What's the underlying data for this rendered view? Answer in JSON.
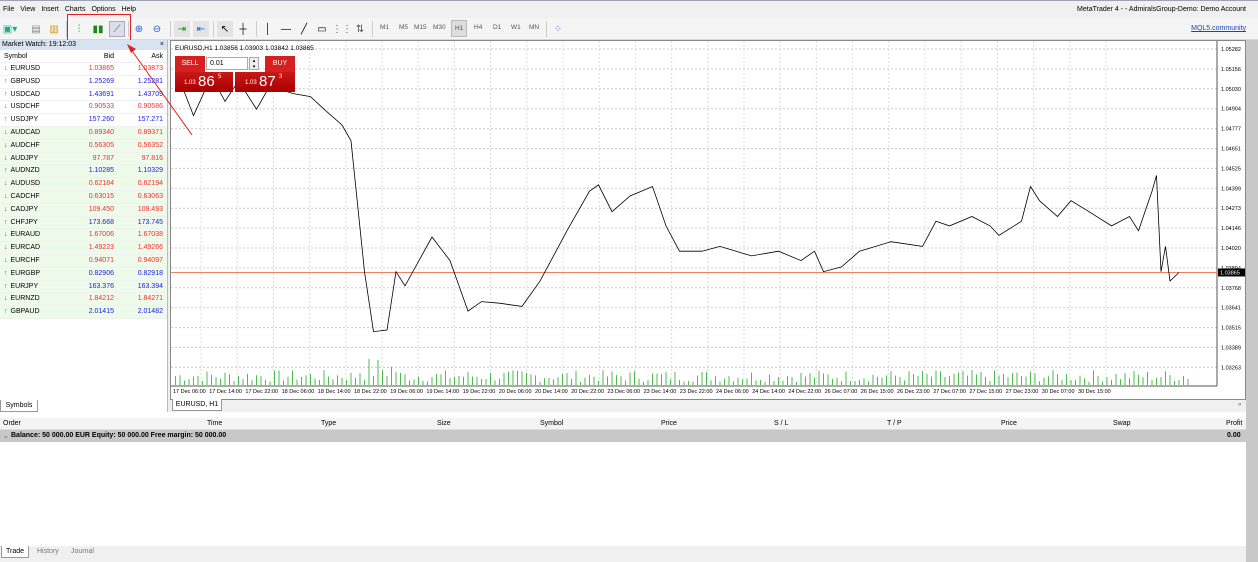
{
  "menu": [
    "File",
    "View",
    "Insert",
    "Charts",
    "Options",
    "Help"
  ],
  "window_title": "MetaTrader 4 -            - AdmiralsGroup-Demo: Demo Account",
  "timeframes": [
    "M1",
    "M5",
    "M15",
    "M30",
    "H1",
    "H4",
    "D1",
    "W1",
    "MN"
  ],
  "active_timeframe": "H1",
  "mql_link": "MQL5.community",
  "market_watch": {
    "title": "Market Watch: 19:12:03",
    "headers": {
      "symbol": "Symbol",
      "bid": "Bid",
      "ask": "Ask"
    },
    "rows": [
      {
        "symbol": "EURUSD",
        "bid": "1.03865",
        "ask": "1.03873",
        "dir": "down"
      },
      {
        "symbol": "GBPUSD",
        "bid": "1.25269",
        "ask": "1.25281",
        "dir": "up"
      },
      {
        "symbol": "USDCAD",
        "bid": "1.43691",
        "ask": "1.43709",
        "dir": "up"
      },
      {
        "symbol": "USDCHF",
        "bid": "0.90533",
        "ask": "0.90586",
        "dir": "down"
      },
      {
        "symbol": "USDJPY",
        "bid": "157.260",
        "ask": "157.271",
        "dir": "up"
      },
      {
        "symbol": "AUDCAD",
        "bid": "0.89340",
        "ask": "0.89371",
        "dir": "down"
      },
      {
        "symbol": "AUDCHF",
        "bid": "0.56305",
        "ask": "0.56352",
        "dir": "down"
      },
      {
        "symbol": "AUDJPY",
        "bid": "97.787",
        "ask": "97.816",
        "dir": "down"
      },
      {
        "symbol": "AUDNZD",
        "bid": "1.10285",
        "ask": "1.10329",
        "dir": "up"
      },
      {
        "symbol": "AUDUSD",
        "bid": "0.62184",
        "ask": "0.62194",
        "dir": "down"
      },
      {
        "symbol": "CADCHF",
        "bid": "0.63015",
        "ask": "0.63063",
        "dir": "down"
      },
      {
        "symbol": "CADJPY",
        "bid": "109.450",
        "ask": "109.493",
        "dir": "down"
      },
      {
        "symbol": "CHFJPY",
        "bid": "173.668",
        "ask": "173.745",
        "dir": "up"
      },
      {
        "symbol": "EURAUD",
        "bid": "1.67006",
        "ask": "1.67038",
        "dir": "down"
      },
      {
        "symbol": "EURCAD",
        "bid": "1.49223",
        "ask": "1.49266",
        "dir": "down"
      },
      {
        "symbol": "EURCHF",
        "bid": "0.94071",
        "ask": "0.94097",
        "dir": "down"
      },
      {
        "symbol": "EURGBP",
        "bid": "0.82906",
        "ask": "0.82918",
        "dir": "up"
      },
      {
        "symbol": "EURJPY",
        "bid": "163.376",
        "ask": "163.394",
        "dir": "up"
      },
      {
        "symbol": "EURNZD",
        "bid": "1.84212",
        "ask": "1.84271",
        "dir": "down"
      },
      {
        "symbol": "GBPAUD",
        "bid": "2.01415",
        "ask": "2.01482",
        "dir": "up"
      }
    ],
    "tab": "Symbols"
  },
  "chart": {
    "header": "EURUSD,H1  1.03856 1.03903 1.03842 1.03865",
    "sell_label": "SELL",
    "buy_label": "BUY",
    "lot": "0.01",
    "sell_prefix": "1.03",
    "sell_big": "86",
    "sell_sup": "5",
    "buy_prefix": "1.03",
    "buy_big": "87",
    "buy_sup": "3",
    "tab": "EURUSD, H1",
    "current_price": "1.03865",
    "price_ticks": [
      "1.05282",
      "1.05156",
      "1.05030",
      "1.04904",
      "1.04777",
      "1.04651",
      "1.04525",
      "1.04399",
      "1.04273",
      "1.04146",
      "1.04020",
      "1.03894",
      "1.03768",
      "1.03641",
      "1.03515",
      "1.03389",
      "1.03263"
    ],
    "time_ticks": [
      "17 Dec 06:00",
      "17 Dec 14:00",
      "17 Dec 22:00",
      "18 Dec 06:00",
      "18 Dec 14:00",
      "18 Dec 22:00",
      "19 Dec 06:00",
      "19 Dec 14:00",
      "19 Dec 22:00",
      "20 Dec 06:00",
      "20 Dec 14:00",
      "20 Dec 22:00",
      "23 Dec 06:00",
      "23 Dec 14:00",
      "23 Dec 22:00",
      "24 Dec 06:00",
      "24 Dec 14:00",
      "24 Dec 22:00",
      "26 Dec 07:00",
      "26 Dec 15:00",
      "26 Dec 23:00",
      "27 Dec 07:00",
      "27 Dec 15:00",
      "27 Dec 23:00",
      "30 Dec 07:00",
      "30 Dec 15:00"
    ]
  },
  "chart_data": {
    "type": "line",
    "title": "EURUSD,H1",
    "ylim": [
      1.032,
      1.053
    ],
    "x": [
      1,
      4,
      8,
      11,
      14,
      18,
      21,
      26,
      30,
      33,
      37,
      39,
      42,
      44,
      47,
      49,
      51,
      57,
      61,
      65,
      68,
      72,
      77,
      81,
      87,
      92,
      94,
      97,
      101,
      106,
      109,
      112,
      117,
      121,
      128,
      134,
      139,
      142,
      144,
      148,
      152,
      159,
      166,
      169,
      172,
      177,
      181,
      183,
      188,
      190,
      192,
      196,
      199,
      203,
      208,
      212,
      214,
      217,
      218,
      219,
      220,
      221,
      223
    ],
    "y": [
      1.0508,
      1.0486,
      1.0511,
      1.0495,
      1.0508,
      1.049,
      1.0505,
      1.05,
      1.0498,
      1.049,
      1.048,
      1.047,
      1.0387,
      1.0349,
      1.035,
      1.0387,
      1.0378,
      1.0409,
      1.0394,
      1.0362,
      1.0368,
      1.0367,
      1.0365,
      1.0381,
      1.0413,
      1.0438,
      1.0442,
      1.0425,
      1.0435,
      1.0441,
      1.0416,
      1.04,
      1.04,
      1.0403,
      1.0397,
      1.04,
      1.0394,
      1.04,
      1.0387,
      1.039,
      1.04,
      1.0406,
      1.0403,
      1.0419,
      1.0416,
      1.0422,
      1.0416,
      1.041,
      1.0419,
      1.0441,
      1.0432,
      1.0422,
      1.0432,
      1.0425,
      1.0416,
      1.0422,
      1.0413,
      1.0438,
      1.0448,
      1.0387,
      1.0403,
      1.0381,
      1.03865
    ]
  },
  "terminal": {
    "headers": [
      "Order",
      "Time",
      "Type",
      "Size",
      "Symbol",
      "Price",
      "S / L",
      "T / P",
      "Price",
      "Swap",
      "Profit"
    ],
    "balance": "Balance: 50 000.00 EUR  Equity: 50 000.00  Free margin: 50 000.00",
    "profit": "0.00",
    "tabs": [
      "Trade",
      "History",
      "Journal"
    ]
  },
  "colors": {
    "annotation": "#e02020",
    "bid_down": "#f03030",
    "bid_up": "#2020e0",
    "volume": "#22aa22",
    "price_line": "#f08060"
  }
}
